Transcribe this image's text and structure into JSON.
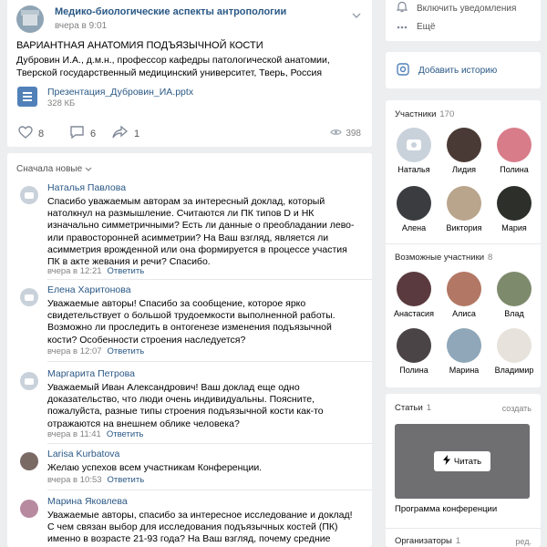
{
  "post": {
    "group_name": "Медико-биологические аспекты антропологии",
    "time": "вчера в 9:01",
    "title": "ВАРИАНТНАЯ АНАТОМИЯ ПОДЪЯЗЫЧНОЙ КОСТИ",
    "lines": [
      "Дубровин И.А., д.м.н., профессор кафедры патологической анатомии,",
      "Тверской государственный медицинский университет, Тверь, Россия"
    ],
    "doc": {
      "name": "Презентация_Дубровин_ИА.pptx",
      "size": "328 КБ"
    },
    "likes": "8",
    "comments": "6",
    "shares": "1",
    "views": "398"
  },
  "comments_section": {
    "sort_label": "Сначала новые",
    "reply_label": "Ответить",
    "items": [
      {
        "name": "Наталья Павлова",
        "text": "Спасибо уважаемым авторам за интересный доклад, который натолкнул на размышление. Считаются ли ПК типов D и НК изначально симметричными? Есть ли данные о преобладании лево- или правосторонней асимметрии? На Ваш взгляд, является ли асимметрия врожденной или она формируется в процессе участия ПК в акте жевания и речи? Спасибо.",
        "time": "вчера в 12:21"
      },
      {
        "name": "Елена Харитонова",
        "text": "Уважаемые авторы! Спасибо за сообщение, которое ярко свидетельствует о большой трудоемкости выполненной работы. Возможно ли проследить в онтогенезе изменения подъязычной кости? Особенности строения наследуется?",
        "time": "вчера в 12:07"
      },
      {
        "name": "Маргарита Петрова",
        "text": "Уважаемый Иван Александрович! Ваш доклад еще одно доказательство, что люди очень индивидуальны. Поясните, пожалуйста, разные типы строения подъязычной кости как-то отражаются на внешнем облике человека?",
        "time": "вчера в 11:41"
      },
      {
        "name": "Larisa Kurbatova",
        "text": "Желаю успехов всем участникам Конференции.",
        "time": "вчера в 10:53"
      },
      {
        "name": "Марина Яковлева",
        "text": "Уважаемые авторы, спасибо за интересное исследование и доклад! С чем связан выбор для исследования подъязычных костей (ПК) именно в возрасте 21-93 года? На Ваш взгляд, почему средние размеры ПК",
        "time": ""
      }
    ]
  },
  "sidebar": {
    "notifications": "Включить уведомления",
    "more": "Ещё",
    "add_story": "Добавить историю",
    "members_title": "Участники",
    "members_count": "170",
    "members": [
      {
        "name": "Наталья",
        "color": "#c9d2db"
      },
      {
        "name": "Лидия",
        "color": "#4a3a35"
      },
      {
        "name": "Полина",
        "color": "#d87c8a"
      },
      {
        "name": "Алена",
        "color": "#3a3c40"
      },
      {
        "name": "Виктория",
        "color": "#b9a58c"
      },
      {
        "name": "Мария",
        "color": "#2d2f2a"
      }
    ],
    "possible_title": "Возможные участники",
    "possible_count": "8",
    "possible": [
      {
        "name": "Анастасия",
        "color": "#5a3a3e"
      },
      {
        "name": "Алиса",
        "color": "#b27865"
      },
      {
        "name": "Влад",
        "color": "#7e8a6c"
      },
      {
        "name": "Полина",
        "color": "#4b4446"
      },
      {
        "name": "Марина",
        "color": "#8fa7b8"
      },
      {
        "name": "Владимир",
        "color": "#e7e3dc"
      }
    ],
    "articles_title": "Статьи",
    "articles_count": "1",
    "articles_create": "создать",
    "read_button": "Читать",
    "article_name": "Программа конференции",
    "organizers_title": "Организаторы",
    "organizers_count": "1",
    "organizers_edit": "ред."
  },
  "colors": {
    "link": "#2a5885",
    "accent": "#5181b8",
    "background": "#edeef0"
  }
}
